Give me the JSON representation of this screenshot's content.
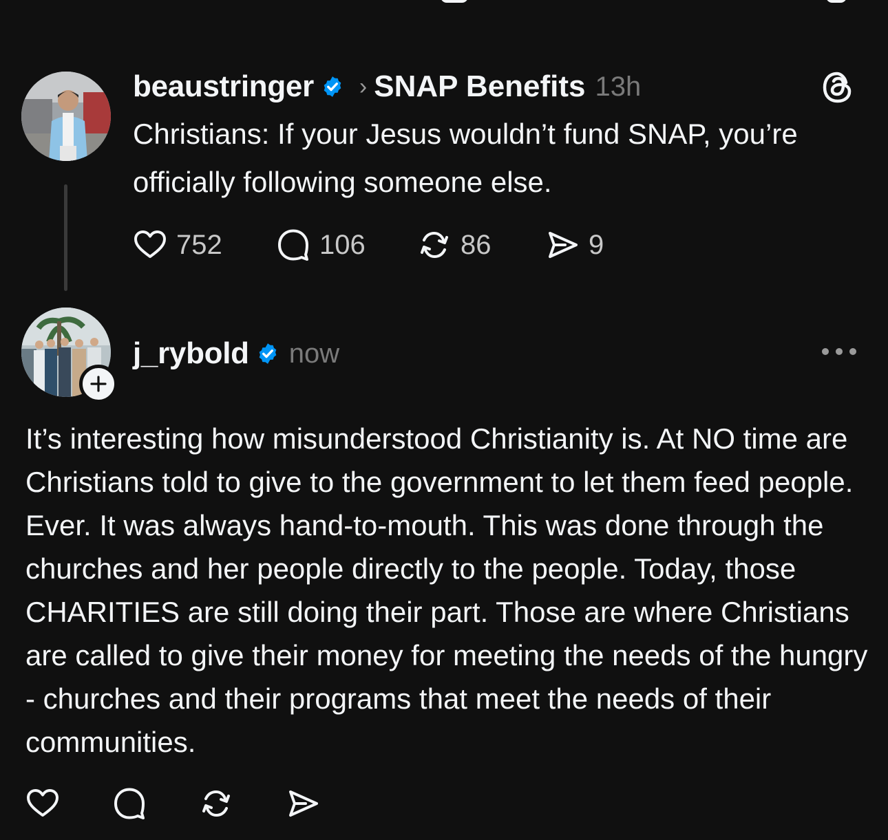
{
  "post1": {
    "username": "beaustringer",
    "topic": "SNAP Benefits",
    "time": "13h",
    "text": "Christians: If your Jesus wouldn’t fund SNAP, you’re officially following someone else.",
    "likes": "752",
    "replies": "106",
    "reposts": "86",
    "shares": "9"
  },
  "post2": {
    "username": "j_rybold",
    "time": "now",
    "text": "It’s interesting how misunderstood Christianity is. At NO time are Christians told to give to the government to let them feed people. Ever. It was always hand-to-mouth. This was done through the churches and her people directly to the people. Today, those CHARITIES are still doing their part. Those are where Christians are called to give their money for meeting the needs of the hungry - churches and their programs that meet the needs of their communities."
  },
  "icons": [
    "verified-icon",
    "chevron-right-icon",
    "threads-logo-icon",
    "heart-icon",
    "comment-icon",
    "repost-icon",
    "share-icon",
    "more-icon",
    "plus-icon"
  ],
  "colors": {
    "background": "#101010",
    "text": "#f3f5f7",
    "muted": "#7a7a7a",
    "verified": "#0095f6",
    "divider": "#3a3a3a"
  }
}
